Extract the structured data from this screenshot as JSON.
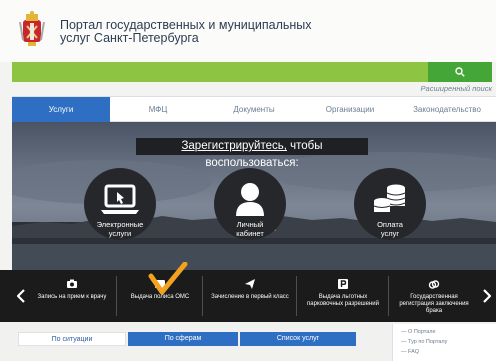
{
  "header": {
    "title_line1": "Портал государственных и муниципальных",
    "title_line2": "услуг Санкт-Петербурга"
  },
  "search": {
    "placeholder": "",
    "extended_link": "Расширенный поиск"
  },
  "nav": {
    "tabs": [
      {
        "label": "Услуги",
        "active": true
      },
      {
        "label": "МФЦ",
        "active": false
      },
      {
        "label": "Документы",
        "active": false
      },
      {
        "label": "Организации",
        "active": false
      },
      {
        "label": "Законодательство",
        "active": false
      }
    ]
  },
  "hero": {
    "banner_link": "Зарегистрируйтесь,",
    "banner_rest": " чтобы воспользоваться:",
    "circles": [
      {
        "line1": "Электронные",
        "line2": "услуги"
      },
      {
        "line1": "Личный",
        "line2": "кабинет"
      },
      {
        "line1": "Оплата",
        "line2": "услуг"
      }
    ]
  },
  "services": {
    "items": [
      {
        "label": "Запись на прием к врачу"
      },
      {
        "label": "Выдача полиса ОМС"
      },
      {
        "label": "Зачисление в первый класс"
      },
      {
        "label": "Выдача льготных парковочных разрешений"
      },
      {
        "label": "Государственная регистрация заключения брака"
      }
    ]
  },
  "bottom": {
    "tabs": [
      {
        "label": "По ситуации"
      },
      {
        "label": "По сферам"
      },
      {
        "label": "Список услуг"
      }
    ],
    "side_links": [
      "О Портале",
      "Тур по Порталу",
      "FAQ"
    ]
  },
  "colors": {
    "primary_blue": "#2f6fc3",
    "search_green": "#8dc542",
    "search_button_green": "#44a637",
    "checkmark_orange": "#f2a21e",
    "dark_bar": "#1b1b1c"
  }
}
